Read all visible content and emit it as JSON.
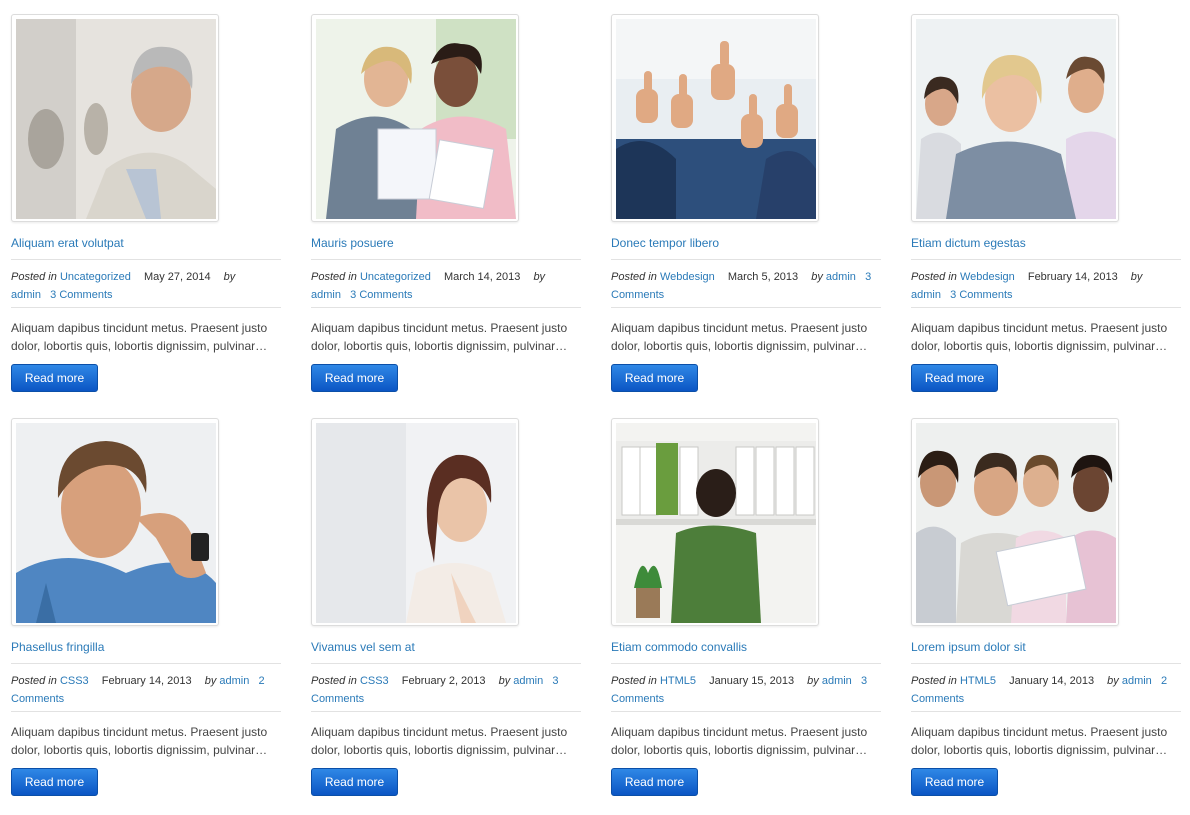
{
  "posts": [
    {
      "title": "Aliquam erat volutpat",
      "posted_in_label": "Posted in",
      "category": "Uncategorized",
      "date": "May 27, 2014",
      "by_label": "by",
      "author": "admin",
      "comments": "3 Comments",
      "excerpt": "Aliquam dapibus tincidunt metus. Praesent justo dolor, lobortis quis, lobortis dignissim, pulvinar…",
      "button": "Read more",
      "image": "businessman-portrait"
    },
    {
      "title": "Mauris posuere",
      "posted_in_label": "Posted in",
      "category": "Uncategorized",
      "date": "March 14, 2013",
      "by_label": "by",
      "author": "admin",
      "comments": "3 Comments",
      "excerpt": "Aliquam dapibus tincidunt metus. Praesent justo dolor, lobortis quis, lobortis dignissim, pulvinar…",
      "button": "Read more",
      "image": "two-women-documents"
    },
    {
      "title": "Donec tempor libero",
      "posted_in_label": "Posted in",
      "category": "Webdesign",
      "date": "March 5, 2013",
      "by_label": "by",
      "author": "admin",
      "comments": "3 Comments",
      "excerpt": "Aliquam dapibus tincidunt metus. Praesent justo dolor, lobortis quis, lobortis dignissim, pulvinar…",
      "button": "Read more",
      "image": "thumbs-up-team"
    },
    {
      "title": "Etiam dictum egestas",
      "posted_in_label": "Posted in",
      "category": "Webdesign",
      "date": "February 14, 2013",
      "by_label": "by",
      "author": "admin",
      "comments": "3 Comments",
      "excerpt": "Aliquam dapibus tincidunt metus. Praesent justo dolor, lobortis quis, lobortis dignissim, pulvinar…",
      "button": "Read more",
      "image": "three-colleagues"
    },
    {
      "title": "Phasellus fringilla",
      "posted_in_label": "Posted in",
      "category": "CSS3",
      "date": "February 14, 2013",
      "by_label": "by",
      "author": "admin",
      "comments": "2 Comments",
      "excerpt": "Aliquam dapibus tincidunt metus. Praesent justo dolor, lobortis quis, lobortis dignissim, pulvinar…",
      "button": "Read more",
      "image": "man-thinking"
    },
    {
      "title": "Vivamus vel sem at",
      "posted_in_label": "Posted in",
      "category": "CSS3",
      "date": "February 2, 2013",
      "by_label": "by",
      "author": "admin",
      "comments": "3 Comments",
      "excerpt": "Aliquam dapibus tincidunt metus. Praesent justo dolor, lobortis quis, lobortis dignissim, pulvinar…",
      "button": "Read more",
      "image": "woman-smiling"
    },
    {
      "title": "Etiam commodo convallis",
      "posted_in_label": "Posted in",
      "category": "HTML5",
      "date": "January 15, 2013",
      "by_label": "by",
      "author": "admin",
      "comments": "3 Comments",
      "excerpt": "Aliquam dapibus tincidunt metus. Praesent justo dolor, lobortis quis, lobortis dignissim, pulvinar…",
      "button": "Read more",
      "image": "woman-at-shelf"
    },
    {
      "title": "Lorem ipsum dolor sit",
      "posted_in_label": "Posted in",
      "category": "HTML5",
      "date": "January 14, 2013",
      "by_label": "by",
      "author": "admin",
      "comments": "2 Comments",
      "excerpt": "Aliquam dapibus tincidunt metus. Praesent justo dolor, lobortis quis, lobortis dignissim, pulvinar…",
      "button": "Read more",
      "image": "group-meeting"
    }
  ]
}
